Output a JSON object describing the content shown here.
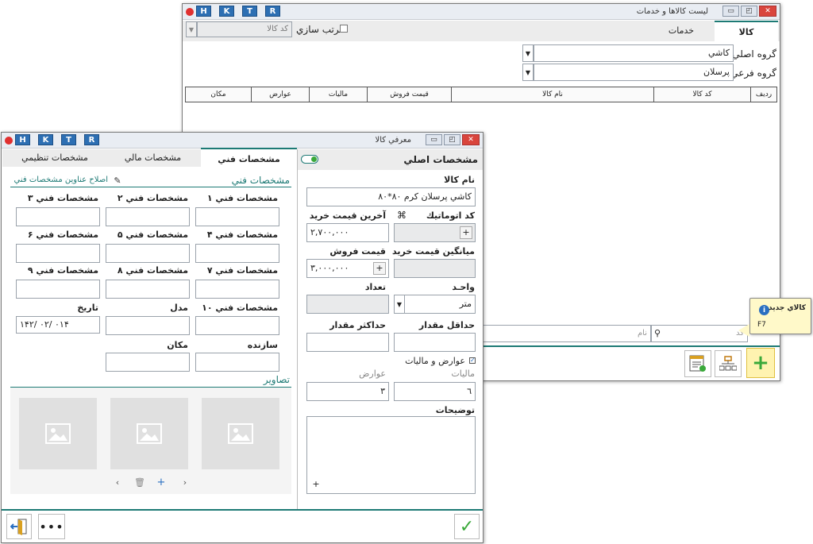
{
  "hktr": [
    "H",
    "K",
    "T",
    "R"
  ],
  "back_window": {
    "title": "ليست كالاها و خدمات",
    "tab_goods": "كالا",
    "tab_services": "خدمات",
    "sort_label": "مرتب سازي",
    "sort_field": "كد كالا",
    "main_group_label": "گروه اصلي",
    "main_group_value": "كاشي",
    "sub_group_label": "گروه فرعي",
    "sub_group_value": "پرسلان",
    "columns": [
      "رديف",
      "كد كالا",
      "نام كالا",
      "قيمت فروش",
      "ماليات",
      "عوارض",
      "مكان"
    ],
    "search_code_placeholder": "كد",
    "search_name_placeholder": "نام"
  },
  "tooltip": {
    "title": "كالاي جديد",
    "shortcut": "F7"
  },
  "front_window": {
    "title": "معرفي كالا",
    "right_header": "مشخصات اصلي",
    "tabs": [
      "مشخصات فني",
      "مشخصات مالي",
      "مشخصات تنظيمي"
    ],
    "name_label": "نام كالا",
    "name_value": "كاشي پرسلان كرم ٨٠*٨٠",
    "auto_code_label": "كد اتوماتيك",
    "last_buy_label": "آخرين قيمت خريد",
    "last_buy_value": "٢,٧٠٠,٠٠٠",
    "avg_buy_label": "ميانگين قيمت خريد",
    "sell_price_label": "قيمت فروش",
    "sell_price_value": "٣,٠٠٠,٠٠٠",
    "unit_label": "واحـد",
    "unit_value": "متر",
    "count_label": "تعداد",
    "min_label": "حداقل مقدار",
    "max_label": "حداكثر مقدار",
    "tax_check_label": "عوارض و ماليات",
    "tax_label": "ماليات",
    "tax_value": "٦",
    "duty_label": "عوارض",
    "duty_value": "٣",
    "desc_label": "توضيحات",
    "tech_header": "مشخصات فني",
    "edit_titles": "اصلاح عناوين مشخصات فني",
    "specs": [
      "مشخصات فني ١",
      "مشخصات فني ٢",
      "مشخصات فني ٣",
      "مشخصات فني ۴",
      "مشخصات فني ۵",
      "مشخصات فني ۶",
      "مشخصات فني ٧",
      "مشخصات فني ٨",
      "مشخصات فني ٩",
      "مشخصات فني ١٠",
      "مدل",
      "تاريخ",
      "سازنده",
      "مكان"
    ],
    "date_value": "١۴٠١   /٠٢  /٢۴",
    "images_label": "تصاوير"
  },
  "colors": {
    "accent": "#1d7a75",
    "add_green": "#3aa93a",
    "tooltip_bg": "#fff9c9"
  }
}
